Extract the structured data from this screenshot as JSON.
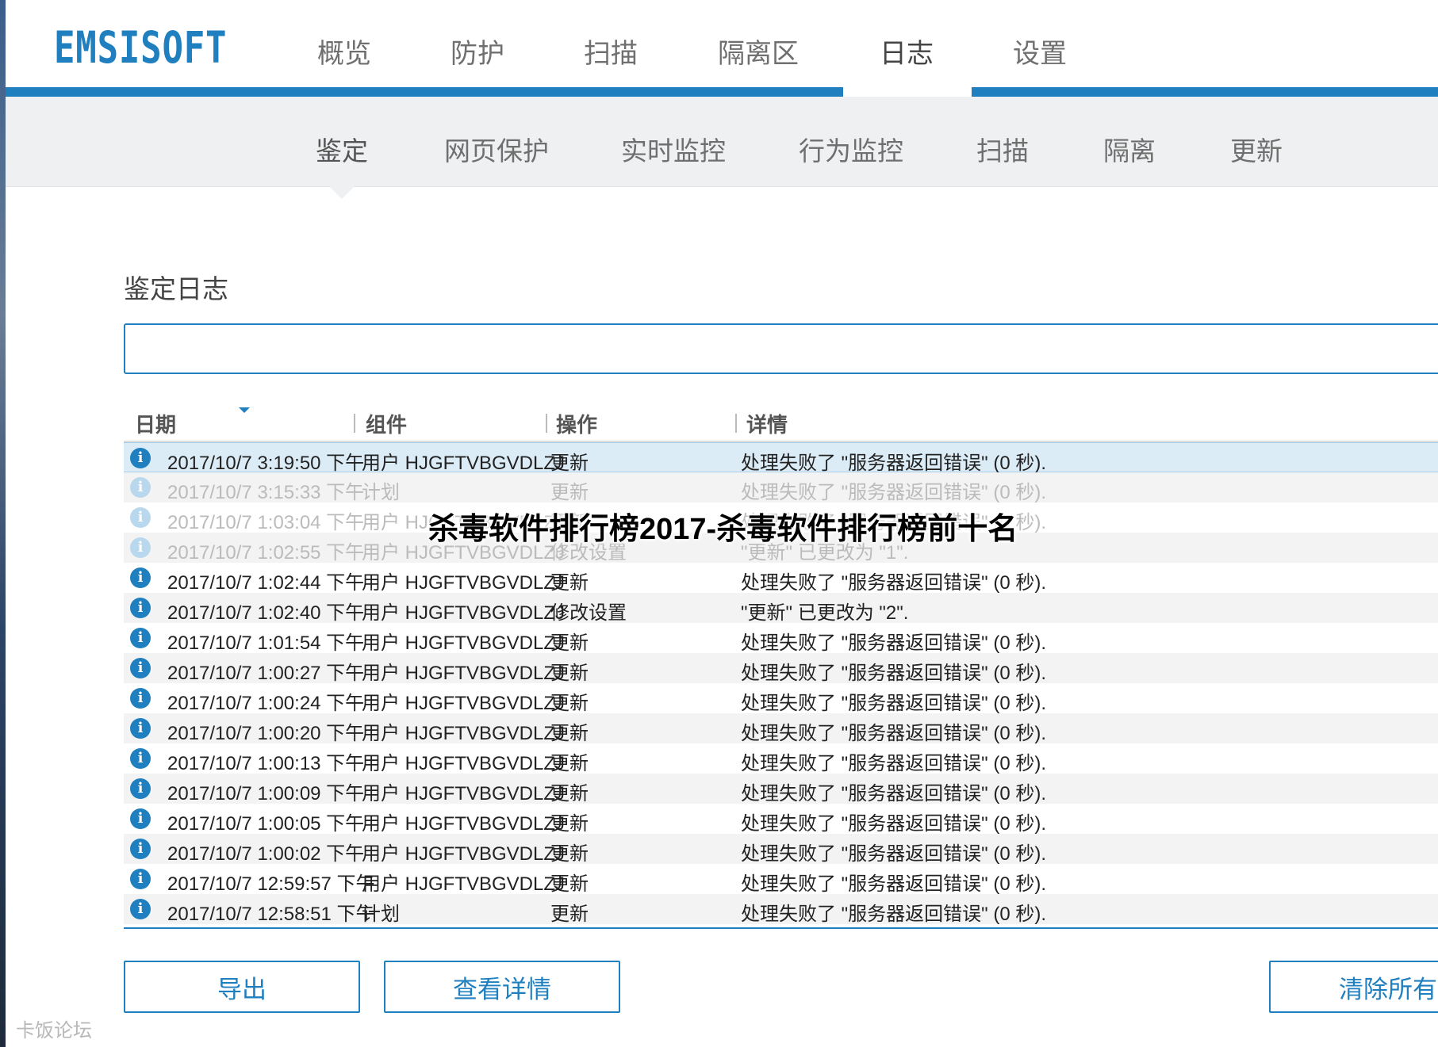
{
  "app": {
    "logo": "EMSISOFT",
    "main_tabs": [
      {
        "label": "概览"
      },
      {
        "label": "防护"
      },
      {
        "label": "扫描"
      },
      {
        "label": "隔离区"
      },
      {
        "label": "日志"
      },
      {
        "label": "设置"
      }
    ],
    "active_main_tab": "日志",
    "sub_tabs": [
      {
        "label": "鉴定"
      },
      {
        "label": "网页保护"
      },
      {
        "label": "实时监控"
      },
      {
        "label": "行为监控"
      },
      {
        "label": "扫描"
      },
      {
        "label": "隔离"
      },
      {
        "label": "更新"
      }
    ],
    "active_sub_tab": "鉴定"
  },
  "main": {
    "section_title": "鉴定日志",
    "search_value": ""
  },
  "table": {
    "headers": {
      "date": "日期",
      "component": "组件",
      "action": "操作",
      "detail": "详情"
    },
    "rows": [
      {
        "date": "2017/10/7 3:19:50 下午",
        "component": "用户 HJGFTVBGVDLZJ",
        "action": "更新",
        "detail": "处理失败了 \"服务器返回错误\" (0 秒).",
        "state": "selected"
      },
      {
        "date": "2017/10/7 3:15:33 下午",
        "component": "计划",
        "action": "更新",
        "detail": "处理失败了 \"服务器返回错误\" (0 秒).",
        "state": "faded"
      },
      {
        "date": "2017/10/7 1:03:04 下午",
        "component": "用户 HJGFTVBGVDLZJ",
        "action": "更新",
        "detail": "处理失败了 \"服务器返回错误\" (0 秒).",
        "state": "faded"
      },
      {
        "date": "2017/10/7 1:02:55 下午",
        "component": "用户 HJGFTVBGVDLZJ",
        "action": "修改设置",
        "detail": "\"更新\" 已更改为 \"1\".",
        "state": "faded"
      },
      {
        "date": "2017/10/7 1:02:44 下午",
        "component": "用户 HJGFTVBGVDLZJ",
        "action": "更新",
        "detail": "处理失败了 \"服务器返回错误\" (0 秒).",
        "state": "normal"
      },
      {
        "date": "2017/10/7 1:02:40 下午",
        "component": "用户 HJGFTVBGVDLZJ",
        "action": "修改设置",
        "detail": "\"更新\" 已更改为 \"2\".",
        "state": "normal"
      },
      {
        "date": "2017/10/7 1:01:54 下午",
        "component": "用户 HJGFTVBGVDLZJ",
        "action": "更新",
        "detail": "处理失败了 \"服务器返回错误\" (0 秒).",
        "state": "normal"
      },
      {
        "date": "2017/10/7 1:00:27 下午",
        "component": "用户 HJGFTVBGVDLZJ",
        "action": "更新",
        "detail": "处理失败了 \"服务器返回错误\" (0 秒).",
        "state": "normal"
      },
      {
        "date": "2017/10/7 1:00:24 下午",
        "component": "用户 HJGFTVBGVDLZJ",
        "action": "更新",
        "detail": "处理失败了 \"服务器返回错误\" (0 秒).",
        "state": "normal"
      },
      {
        "date": "2017/10/7 1:00:20 下午",
        "component": "用户 HJGFTVBGVDLZJ",
        "action": "更新",
        "detail": "处理失败了 \"服务器返回错误\" (0 秒).",
        "state": "normal"
      },
      {
        "date": "2017/10/7 1:00:13 下午",
        "component": "用户 HJGFTVBGVDLZJ",
        "action": "更新",
        "detail": "处理失败了 \"服务器返回错误\" (0 秒).",
        "state": "normal"
      },
      {
        "date": "2017/10/7 1:00:09 下午",
        "component": "用户 HJGFTVBGVDLZJ",
        "action": "更新",
        "detail": "处理失败了 \"服务器返回错误\" (0 秒).",
        "state": "normal"
      },
      {
        "date": "2017/10/7 1:00:05 下午",
        "component": "用户 HJGFTVBGVDLZJ",
        "action": "更新",
        "detail": "处理失败了 \"服务器返回错误\" (0 秒).",
        "state": "normal"
      },
      {
        "date": "2017/10/7 1:00:02 下午",
        "component": "用户 HJGFTVBGVDLZJ",
        "action": "更新",
        "detail": "处理失败了 \"服务器返回错误\" (0 秒).",
        "state": "normal"
      },
      {
        "date": "2017/10/7 12:59:57 下午",
        "component": "用户 HJGFTVBGVDLZJ",
        "action": "更新",
        "detail": "处理失败了 \"服务器返回错误\" (0 秒).",
        "state": "normal"
      },
      {
        "date": "2017/10/7 12:58:51 下午",
        "component": "计划",
        "action": "更新",
        "detail": "处理失败了 \"服务器返回错误\" (0 秒).",
        "state": "normal"
      }
    ]
  },
  "buttons": {
    "export": "导出",
    "view_details": "查看详情",
    "clear_all": "清除所有"
  },
  "overlay": {
    "title": "杀毒软件排行榜2017-杀毒软件排行榜前十名",
    "watermark": "卡饭论坛"
  },
  "colors": {
    "accent": "#1f7fbf",
    "subnav_bg": "#eef0f1",
    "selected_row": "#dcecf7"
  },
  "icons": {
    "row_icon": "info-icon",
    "sort": "sort-descending-icon"
  }
}
